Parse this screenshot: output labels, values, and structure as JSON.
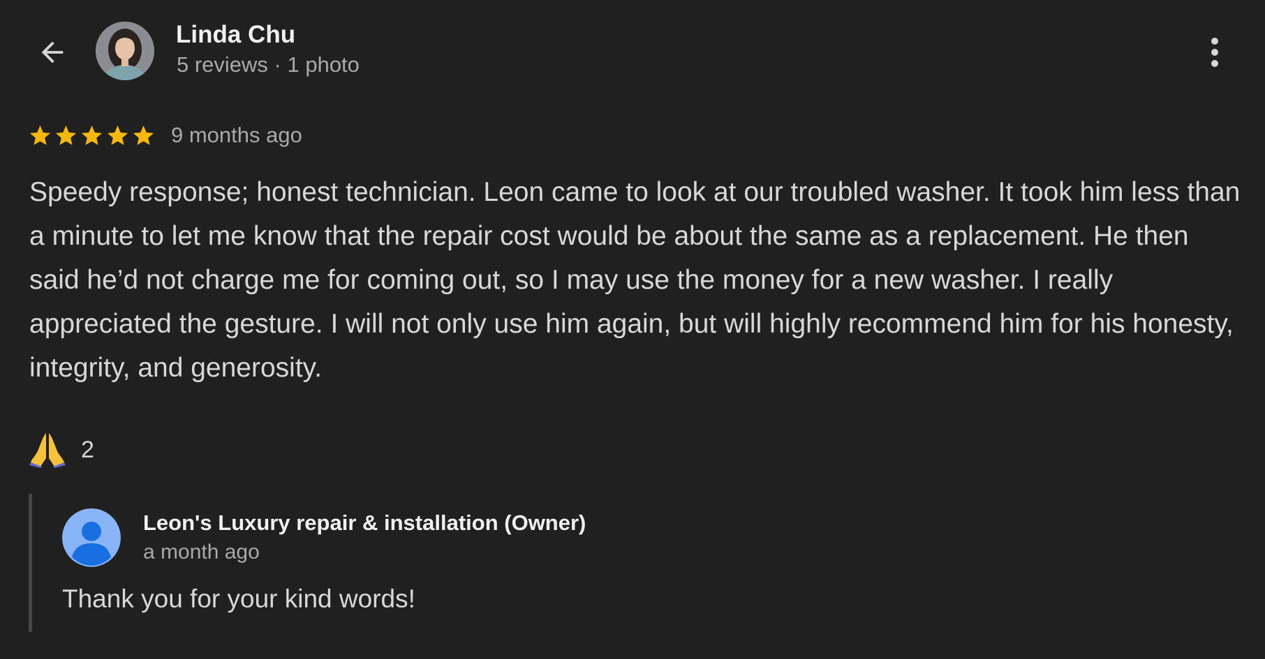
{
  "header": {
    "back_icon": "arrow-left-icon",
    "reviewer_name": "Linda Chu",
    "reviewer_meta": "5 reviews · 1 photo",
    "more_icon": "more-vert-icon"
  },
  "review": {
    "rating": 5,
    "rating_max": 5,
    "date": "9 months ago",
    "text": "Speedy response; honest technician. Leon came to look at our troubled washer. It took him less than a minute to let me know that the repair cost would be about the same as a replacement. He then said he’d not charge me for coming out, so I may use the money for a new washer. I really appreciated the gesture. I will not only use him again, but will highly recommend him for his honesty, integrity, and generosity.",
    "reaction_icon": "folded-hands-emoji",
    "reaction_emoji": "🙏",
    "reaction_count": "2"
  },
  "owner_reply": {
    "name": "Leon's Luxury repair & installation (Owner)",
    "date": "a month ago",
    "text": "Thank you for your kind words!",
    "avatar_icon": "default-user-avatar-icon"
  },
  "colors": {
    "background": "#202020",
    "star": "#f6b70f",
    "owner_avatar_bg": "#8ab4f8",
    "owner_avatar_fg": "#1a6fe0",
    "reply_bar": "#474747"
  }
}
